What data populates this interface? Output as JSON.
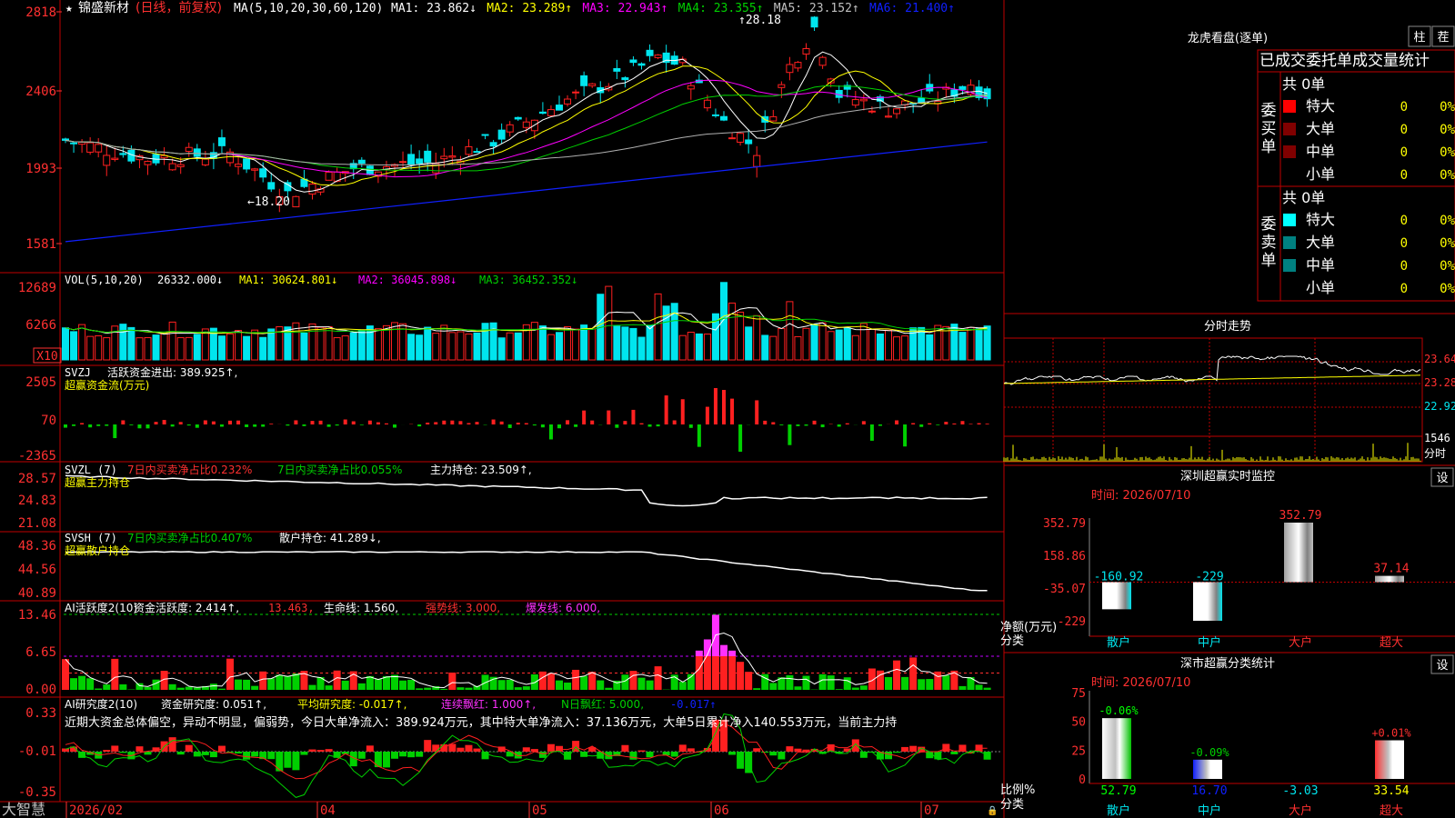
{
  "colors": {
    "up": "#ff2020",
    "down": "#00e5ee",
    "frame": "#c00000",
    "ma1": "#ffffff",
    "ma2": "#ffff00",
    "ma3": "#ff00ff",
    "ma4": "#00d000",
    "ma5": "#b0b0b0",
    "ma6": "#1020ff",
    "green": "#00d000"
  },
  "main": {
    "title_star": "★",
    "stock": "锦盛新材",
    "mode": "(日线，前复权)",
    "ma_params": "MA(5,10,20,30,60,120)",
    "ma_items": [
      {
        "label": "MA1: 23.862",
        "arrow": "↓",
        "color": "#ffffff"
      },
      {
        "label": "MA2: 23.289",
        "arrow": "↑",
        "color": "#ffff00"
      },
      {
        "label": "MA3: 22.943",
        "arrow": "↑",
        "color": "#ff00ff"
      },
      {
        "label": "MA4: 23.355",
        "arrow": "↑",
        "color": "#00d000"
      },
      {
        "label": "MA5: 23.152",
        "arrow": "↑",
        "color": "#c0c0c0"
      },
      {
        "label": "MA6: 21.400",
        "arrow": "↑",
        "color": "#1020ff"
      }
    ],
    "yticks": [
      "2818",
      "2406",
      "1993",
      "1581"
    ],
    "high_label": "28.18",
    "low_label": "18.20"
  },
  "vol": {
    "title": "VOL(5,10,20)",
    "v": "26332.000",
    "arrow": "↓",
    "ma1": "MA1: 30624.801",
    "ma1a": "↓",
    "ma2": "MA2: 36045.898",
    "ma2a": "↓",
    "ma3": "MA3: 36452.352",
    "ma3a": "↓",
    "yticks": [
      "12689",
      "6266"
    ],
    "unit": "X10"
  },
  "svzj": {
    "title": "SVZJ",
    "item": "活跃资金进出: 389.925",
    "arrow": "↑",
    "sub": "超赢资金流(万元)",
    "yticks": [
      "2505",
      "70",
      "-2365"
    ]
  },
  "svzl": {
    "title": "SVZL (7)",
    "t1": "7日内买卖净占比0.232%",
    "t2": "7日内买卖净占比0.055%",
    "t3": "主力持仓: 23.509",
    "arrow": "↑",
    "sub": "超赢主力持仓",
    "yticks": [
      "28.57",
      "24.83",
      "21.08"
    ]
  },
  "svsh": {
    "title": "SVSH (7)",
    "t1": "7日内买卖净占比0.407%",
    "t2": "散户持仓: 41.289",
    "arrow": "↓",
    "sub": "超赢散户持仓",
    "yticks": [
      "48.36",
      "44.56",
      "40.89"
    ]
  },
  "ai1": {
    "title": "AI活跃度2(10)",
    "t1": "资金活跃度: 2.414",
    "a1": "↑",
    "t2": "13.463",
    "t3": "生命线: 1.560",
    "t4": "强势线: 3.000",
    "t5": "爆发线: 6.000",
    "yticks": [
      "13.46",
      "6.65",
      "0.00"
    ]
  },
  "ai2": {
    "title": "AI研究度2(10)",
    "t1": "资金研究度: 0.051",
    "a1": "↑",
    "t2": "平均研究度: -0.017",
    "a2": "↑",
    "t3": "连续飘红: 1.000",
    "a3": "↑",
    "t4": "N日飘红: 5.000",
    "t5": "-0.017",
    "a5": "↑",
    "desc": "近期大资金总体偏空，异动不明显，偏弱势，今日大单净流入：389.924万元，其中特大单净流入：37.136万元，大单5日累计净入140.553万元，当前主力持",
    "yticks": [
      "0.33",
      "-0.01",
      "-0.35"
    ]
  },
  "footer": {
    "brand": "大智慧",
    "dates": [
      "2026/02",
      "04",
      "05",
      "06",
      "07"
    ]
  },
  "lhb": {
    "title": "龙虎看盘(逐单)",
    "btn1": "柱",
    "btn2": "茬",
    "header": "已成交委托单成交量统计",
    "buy_label": "委买单",
    "sell_label": "委卖单",
    "buy_total": "共 0单",
    "sell_total": "共 0单",
    "rows": [
      {
        "name": "特大",
        "count": "0",
        "pct": "0%"
      },
      {
        "name": "大单",
        "count": "0",
        "pct": "0%"
      },
      {
        "name": "中单",
        "count": "0",
        "pct": "0%"
      },
      {
        "name": "小单",
        "count": "0",
        "pct": "0%"
      }
    ]
  },
  "intraday": {
    "title": "分时走势",
    "yticks": [
      "23.64",
      "23.28",
      "22.92"
    ],
    "vol_tick": "1546",
    "vol_label": "分时"
  },
  "sz_monitor": {
    "title": "深圳超赢实时监控",
    "btn": "设",
    "date": "时间: 2026/07/10",
    "ylabel": "净额(万元)",
    "xlabel": "分类",
    "yticks": [
      "352.79",
      "158.86",
      "-35.07",
      "-229"
    ],
    "chart_data": {
      "type": "bar",
      "categories": [
        "散户",
        "中户",
        "大户",
        "超大"
      ],
      "values": [
        -160.92,
        -229,
        352.79,
        37.14
      ],
      "ylim": [
        -229,
        352.79
      ],
      "labels": [
        "-160.92",
        "-229",
        "352.79",
        "37.14"
      ]
    }
  },
  "sh_stats": {
    "title": "深市超赢分类统计",
    "btn": "设",
    "date": "时间: 2026/07/10",
    "ylabel": "比例%",
    "xlabel": "分类",
    "yticks": [
      "75",
      "50",
      "25",
      "0"
    ],
    "chart_data": {
      "type": "bar",
      "categories": [
        "散户",
        "中户",
        "大户",
        "超大"
      ],
      "values": [
        52.79,
        16.7,
        -3.03,
        33.54
      ],
      "change": [
        "-0.06%",
        "-0.09%",
        "",
        "+0.01%"
      ],
      "ylim": [
        0,
        75
      ],
      "labels": [
        "52.79",
        "16.70",
        "-3.03",
        "33.54"
      ]
    }
  }
}
